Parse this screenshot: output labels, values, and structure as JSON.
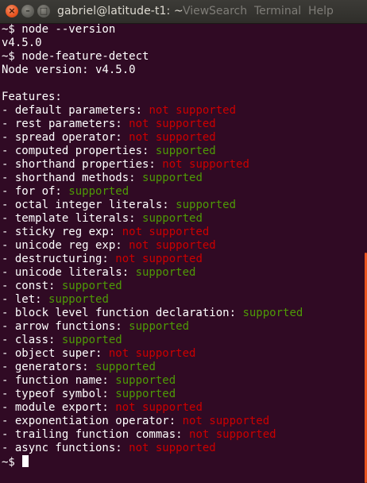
{
  "window": {
    "title": "gabriel@latitude-t1: ~",
    "close_glyph": "×",
    "minimize_glyph": "–",
    "maximize_glyph": "□"
  },
  "menu": {
    "items": [
      "View",
      "Search",
      "Terminal",
      "Help"
    ]
  },
  "terminal": {
    "lines": [
      {
        "text": "~$ node --version",
        "status": ""
      },
      {
        "text": "v4.5.0",
        "status": ""
      },
      {
        "text": "~$ node-feature-detect",
        "status": ""
      },
      {
        "text": "Node version: v4.5.0",
        "status": ""
      },
      {
        "text": "",
        "status": ""
      },
      {
        "text": "Features:",
        "status": ""
      },
      {
        "text": "- default parameters: ",
        "status": "not supported"
      },
      {
        "text": "- rest parameters: ",
        "status": "not supported"
      },
      {
        "text": "- spread operator: ",
        "status": "not supported"
      },
      {
        "text": "- computed properties: ",
        "status": "supported"
      },
      {
        "text": "- shorthand properties: ",
        "status": "not supported"
      },
      {
        "text": "- shorthand methods: ",
        "status": "supported"
      },
      {
        "text": "- for of: ",
        "status": "supported"
      },
      {
        "text": "- octal integer literals: ",
        "status": "supported"
      },
      {
        "text": "- template literals: ",
        "status": "supported"
      },
      {
        "text": "- sticky reg exp: ",
        "status": "not supported"
      },
      {
        "text": "- unicode reg exp: ",
        "status": "not supported"
      },
      {
        "text": "- destructuring: ",
        "status": "not supported"
      },
      {
        "text": "- unicode literals: ",
        "status": "supported"
      },
      {
        "text": "- const: ",
        "status": "supported"
      },
      {
        "text": "- let: ",
        "status": "supported"
      },
      {
        "text": "- block level function declaration: ",
        "status": "supported"
      },
      {
        "text": "- arrow functions: ",
        "status": "supported"
      },
      {
        "text": "- class: ",
        "status": "supported"
      },
      {
        "text": "- object super: ",
        "status": "not supported"
      },
      {
        "text": "- generators: ",
        "status": "supported"
      },
      {
        "text": "- function name: ",
        "status": "supported"
      },
      {
        "text": "- typeof symbol: ",
        "status": "supported"
      },
      {
        "text": "- module export: ",
        "status": "not supported"
      },
      {
        "text": "- exponentiation operator: ",
        "status": "not supported"
      },
      {
        "text": "- trailing function commas: ",
        "status": "not supported"
      },
      {
        "text": "- async functions: ",
        "status": "not supported"
      }
    ],
    "prompt": "~$ "
  },
  "colors": {
    "background": "#300a24",
    "supported": "#4e9a06",
    "not_supported": "#cc0000",
    "text": "#ffffff",
    "accent": "#e95420"
  }
}
